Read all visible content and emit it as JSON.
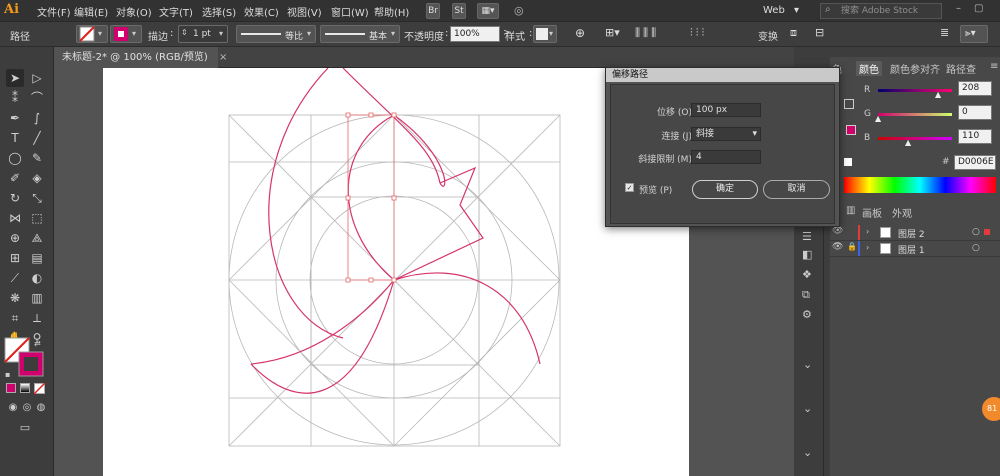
{
  "app": {
    "logo": "Ai",
    "menus": [
      "文件(F)",
      "编辑(E)",
      "对象(O)",
      "文字(T)",
      "选择(S)",
      "效果(C)",
      "视图(V)",
      "窗口(W)",
      "帮助(H)"
    ],
    "bridge_button": "Br",
    "stock_button": "St",
    "workspace": "Web",
    "stock_search_placeholder": "搜索 Adobe Stock"
  },
  "control_bar": {
    "selection_label": "路径",
    "stroke_label": "描边",
    "stroke_weight": "1 pt",
    "profile_label": "等比",
    "brush_label": "基本",
    "opacity_label": "不透明度",
    "opacity_value": "100%",
    "style_label": "样式",
    "transform_label": "变换"
  },
  "document_tab": {
    "title": "未标题-2* @ 100% (RGB/预览)",
    "close_glyph": "×"
  },
  "offset_dialog": {
    "title": "偏移路径",
    "offset_label": "位移 (O):",
    "offset_value": "100 px",
    "joins_label": "连接 (J):",
    "joins_value": "斜接",
    "miter_label": "斜接限制 (M):",
    "miter_value": "4",
    "preview_label": "预览 (P)",
    "preview_checked": true,
    "ok_label": "确定",
    "cancel_label": "取消"
  },
  "color_panel": {
    "tabs": [
      "色",
      "颜色",
      "颜色参",
      "对齐",
      "路径查"
    ],
    "R": 208,
    "G": 0,
    "B": 110,
    "hex": "D0006E",
    "fill_color": "#d0006e"
  },
  "layers_panel": {
    "tabs": [
      "画板",
      "外观"
    ],
    "layers": [
      {
        "name": "图层 2",
        "color": "#e03c3c"
      },
      {
        "name": "图层 1",
        "color": "#3c64e0"
      }
    ]
  },
  "badge": "81"
}
